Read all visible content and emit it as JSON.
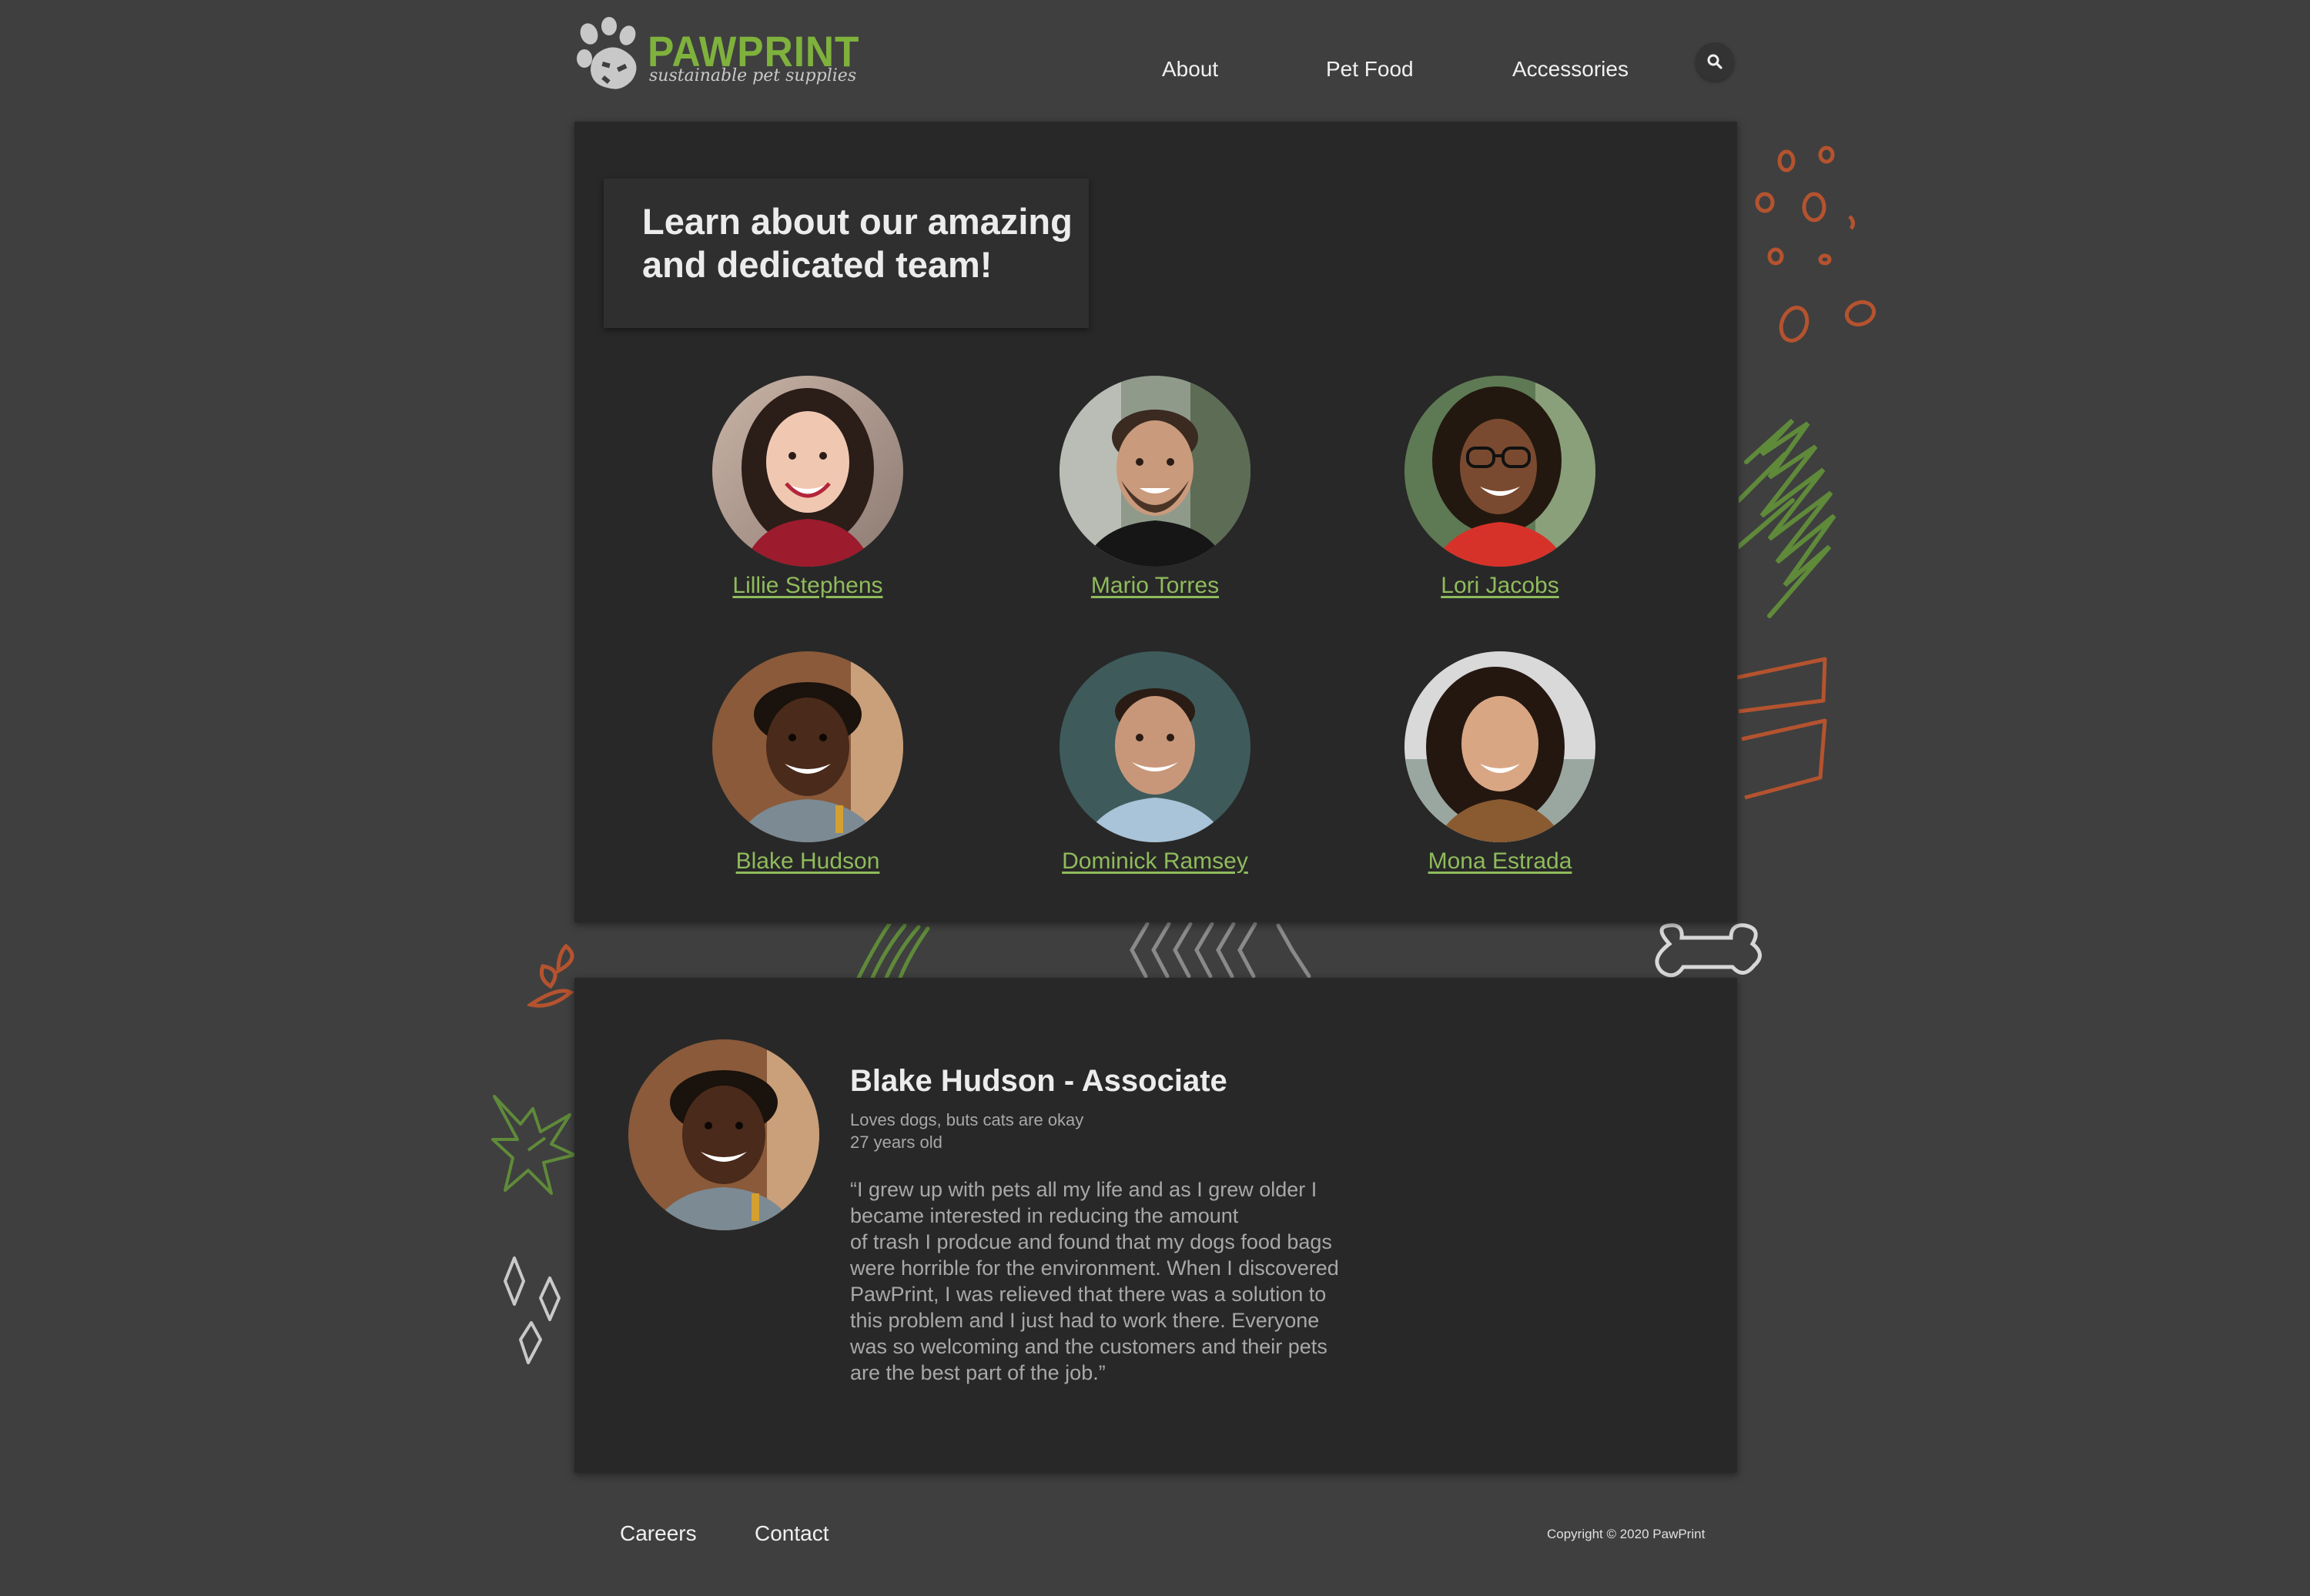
{
  "brand": {
    "name": "PAWPRINT",
    "tagline": "sustainable pet supplies",
    "accent_color": "#7fb13d"
  },
  "nav": {
    "items": [
      "About",
      "Pet Food",
      "Accessories"
    ],
    "search_icon": "search-icon"
  },
  "team": {
    "heading": "Learn about our amazing and dedicated team!",
    "members": [
      {
        "name": "Lillie Stephens"
      },
      {
        "name": "Mario Torres"
      },
      {
        "name": "Lori Jacobs"
      },
      {
        "name": "Blake Hudson"
      },
      {
        "name": "Dominick Ramsey"
      },
      {
        "name": "Mona Estrada"
      }
    ]
  },
  "detail": {
    "title": "Blake Hudson - Associate",
    "tagline": "Loves dogs, buts cats are okay",
    "age": "27 years old",
    "quote_lines": [
      "“I grew up with pets all my life and as I grew older I",
      "became interested in reducing the amount",
      "of trash I prodcue and found that my dogs food bags",
      "were horrible for the environment. When I discovered",
      "PawPrint, I was relieved that there was a solution to",
      "this problem and I just had to work there. Everyone",
      "was so welcoming and the customers and their pets",
      "are the best part of the job.”"
    ]
  },
  "footer": {
    "links": [
      "Careers",
      "Contact"
    ],
    "copyright": "Copyright © 2020 PawPrint"
  },
  "colors": {
    "background": "#3f3f3f",
    "panel": "#282828",
    "link_green": "#8fbb5c",
    "deco_orange": "#b5532f",
    "deco_green": "#5f8a3a"
  }
}
